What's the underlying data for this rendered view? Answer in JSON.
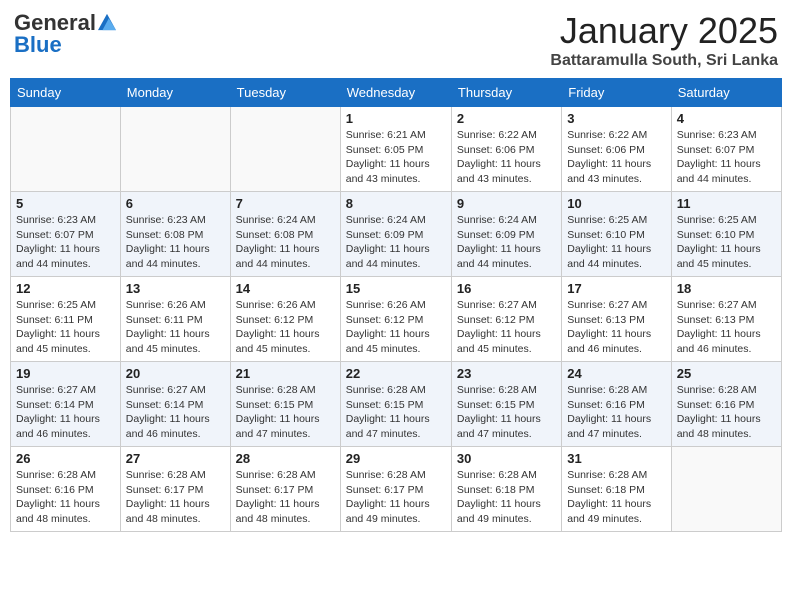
{
  "header": {
    "logo_general": "General",
    "logo_blue": "Blue",
    "month": "January 2025",
    "location": "Battaramulla South, Sri Lanka"
  },
  "weekdays": [
    "Sunday",
    "Monday",
    "Tuesday",
    "Wednesday",
    "Thursday",
    "Friday",
    "Saturday"
  ],
  "weeks": [
    [
      {
        "day": "",
        "info": ""
      },
      {
        "day": "",
        "info": ""
      },
      {
        "day": "",
        "info": ""
      },
      {
        "day": "1",
        "info": "Sunrise: 6:21 AM\nSunset: 6:05 PM\nDaylight: 11 hours\nand 43 minutes."
      },
      {
        "day": "2",
        "info": "Sunrise: 6:22 AM\nSunset: 6:06 PM\nDaylight: 11 hours\nand 43 minutes."
      },
      {
        "day": "3",
        "info": "Sunrise: 6:22 AM\nSunset: 6:06 PM\nDaylight: 11 hours\nand 43 minutes."
      },
      {
        "day": "4",
        "info": "Sunrise: 6:23 AM\nSunset: 6:07 PM\nDaylight: 11 hours\nand 44 minutes."
      }
    ],
    [
      {
        "day": "5",
        "info": "Sunrise: 6:23 AM\nSunset: 6:07 PM\nDaylight: 11 hours\nand 44 minutes."
      },
      {
        "day": "6",
        "info": "Sunrise: 6:23 AM\nSunset: 6:08 PM\nDaylight: 11 hours\nand 44 minutes."
      },
      {
        "day": "7",
        "info": "Sunrise: 6:24 AM\nSunset: 6:08 PM\nDaylight: 11 hours\nand 44 minutes."
      },
      {
        "day": "8",
        "info": "Sunrise: 6:24 AM\nSunset: 6:09 PM\nDaylight: 11 hours\nand 44 minutes."
      },
      {
        "day": "9",
        "info": "Sunrise: 6:24 AM\nSunset: 6:09 PM\nDaylight: 11 hours\nand 44 minutes."
      },
      {
        "day": "10",
        "info": "Sunrise: 6:25 AM\nSunset: 6:10 PM\nDaylight: 11 hours\nand 44 minutes."
      },
      {
        "day": "11",
        "info": "Sunrise: 6:25 AM\nSunset: 6:10 PM\nDaylight: 11 hours\nand 45 minutes."
      }
    ],
    [
      {
        "day": "12",
        "info": "Sunrise: 6:25 AM\nSunset: 6:11 PM\nDaylight: 11 hours\nand 45 minutes."
      },
      {
        "day": "13",
        "info": "Sunrise: 6:26 AM\nSunset: 6:11 PM\nDaylight: 11 hours\nand 45 minutes."
      },
      {
        "day": "14",
        "info": "Sunrise: 6:26 AM\nSunset: 6:12 PM\nDaylight: 11 hours\nand 45 minutes."
      },
      {
        "day": "15",
        "info": "Sunrise: 6:26 AM\nSunset: 6:12 PM\nDaylight: 11 hours\nand 45 minutes."
      },
      {
        "day": "16",
        "info": "Sunrise: 6:27 AM\nSunset: 6:12 PM\nDaylight: 11 hours\nand 45 minutes."
      },
      {
        "day": "17",
        "info": "Sunrise: 6:27 AM\nSunset: 6:13 PM\nDaylight: 11 hours\nand 46 minutes."
      },
      {
        "day": "18",
        "info": "Sunrise: 6:27 AM\nSunset: 6:13 PM\nDaylight: 11 hours\nand 46 minutes."
      }
    ],
    [
      {
        "day": "19",
        "info": "Sunrise: 6:27 AM\nSunset: 6:14 PM\nDaylight: 11 hours\nand 46 minutes."
      },
      {
        "day": "20",
        "info": "Sunrise: 6:27 AM\nSunset: 6:14 PM\nDaylight: 11 hours\nand 46 minutes."
      },
      {
        "day": "21",
        "info": "Sunrise: 6:28 AM\nSunset: 6:15 PM\nDaylight: 11 hours\nand 47 minutes."
      },
      {
        "day": "22",
        "info": "Sunrise: 6:28 AM\nSunset: 6:15 PM\nDaylight: 11 hours\nand 47 minutes."
      },
      {
        "day": "23",
        "info": "Sunrise: 6:28 AM\nSunset: 6:15 PM\nDaylight: 11 hours\nand 47 minutes."
      },
      {
        "day": "24",
        "info": "Sunrise: 6:28 AM\nSunset: 6:16 PM\nDaylight: 11 hours\nand 47 minutes."
      },
      {
        "day": "25",
        "info": "Sunrise: 6:28 AM\nSunset: 6:16 PM\nDaylight: 11 hours\nand 48 minutes."
      }
    ],
    [
      {
        "day": "26",
        "info": "Sunrise: 6:28 AM\nSunset: 6:16 PM\nDaylight: 11 hours\nand 48 minutes."
      },
      {
        "day": "27",
        "info": "Sunrise: 6:28 AM\nSunset: 6:17 PM\nDaylight: 11 hours\nand 48 minutes."
      },
      {
        "day": "28",
        "info": "Sunrise: 6:28 AM\nSunset: 6:17 PM\nDaylight: 11 hours\nand 48 minutes."
      },
      {
        "day": "29",
        "info": "Sunrise: 6:28 AM\nSunset: 6:17 PM\nDaylight: 11 hours\nand 49 minutes."
      },
      {
        "day": "30",
        "info": "Sunrise: 6:28 AM\nSunset: 6:18 PM\nDaylight: 11 hours\nand 49 minutes."
      },
      {
        "day": "31",
        "info": "Sunrise: 6:28 AM\nSunset: 6:18 PM\nDaylight: 11 hours\nand 49 minutes."
      },
      {
        "day": "",
        "info": ""
      }
    ]
  ]
}
